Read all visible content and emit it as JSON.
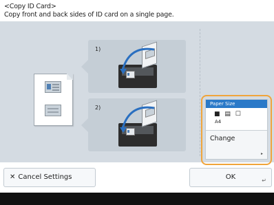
{
  "header": {
    "title": "<Copy ID Card>",
    "description": "Copy front and back sides of ID card on a single page."
  },
  "steps": [
    {
      "label": "1)"
    },
    {
      "label": "2)"
    }
  ],
  "paper_size": {
    "title": "Paper Size",
    "icons": "■ ▤ ☐",
    "value": "A4",
    "change_label": "Change"
  },
  "buttons": {
    "cancel_label": "Cancel Settings",
    "ok_label": "OK"
  },
  "colors": {
    "highlight": "#f0a43a",
    "title_bar": "#2a79c8",
    "panel": "#d4dbe2"
  }
}
